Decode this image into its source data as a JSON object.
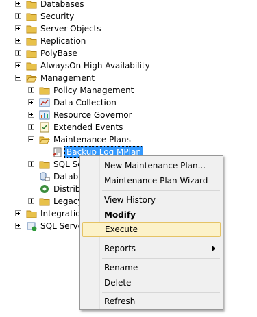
{
  "tree": {
    "top_nodes": [
      {
        "label": "Databases"
      },
      {
        "label": "Security"
      },
      {
        "label": "Server Objects"
      },
      {
        "label": "Replication"
      },
      {
        "label": "PolyBase"
      },
      {
        "label": "AlwaysOn High Availability"
      },
      {
        "label": "Management"
      }
    ],
    "management_children": [
      {
        "label": "Policy Management"
      },
      {
        "label": "Data Collection"
      },
      {
        "label": "Resource Governor"
      },
      {
        "label": "Extended Events"
      },
      {
        "label": "Maintenance Plans"
      }
    ],
    "selected_plan": "Backup Log MPlan",
    "partial_nodes": [
      {
        "label": "SQL Ser"
      },
      {
        "label": "Databa"
      },
      {
        "label": "Distribu"
      },
      {
        "label": "Legacy"
      }
    ],
    "bottom_nodes": [
      {
        "label": "Integration"
      },
      {
        "label": "SQL Server"
      }
    ]
  },
  "context_menu": {
    "items": [
      {
        "label": "New Maintenance Plan..."
      },
      {
        "label": "Maintenance Plan Wizard"
      },
      {
        "label": "View History"
      },
      {
        "label": "Modify"
      },
      {
        "label": "Execute"
      },
      {
        "label": "Reports"
      },
      {
        "label": "Rename"
      },
      {
        "label": "Delete"
      },
      {
        "label": "Refresh"
      }
    ]
  },
  "colors": {
    "folder": "#e8c14a",
    "selection": "#3399ff",
    "hover_bg": "#fcf2c9",
    "hover_border": "#e5c365"
  }
}
